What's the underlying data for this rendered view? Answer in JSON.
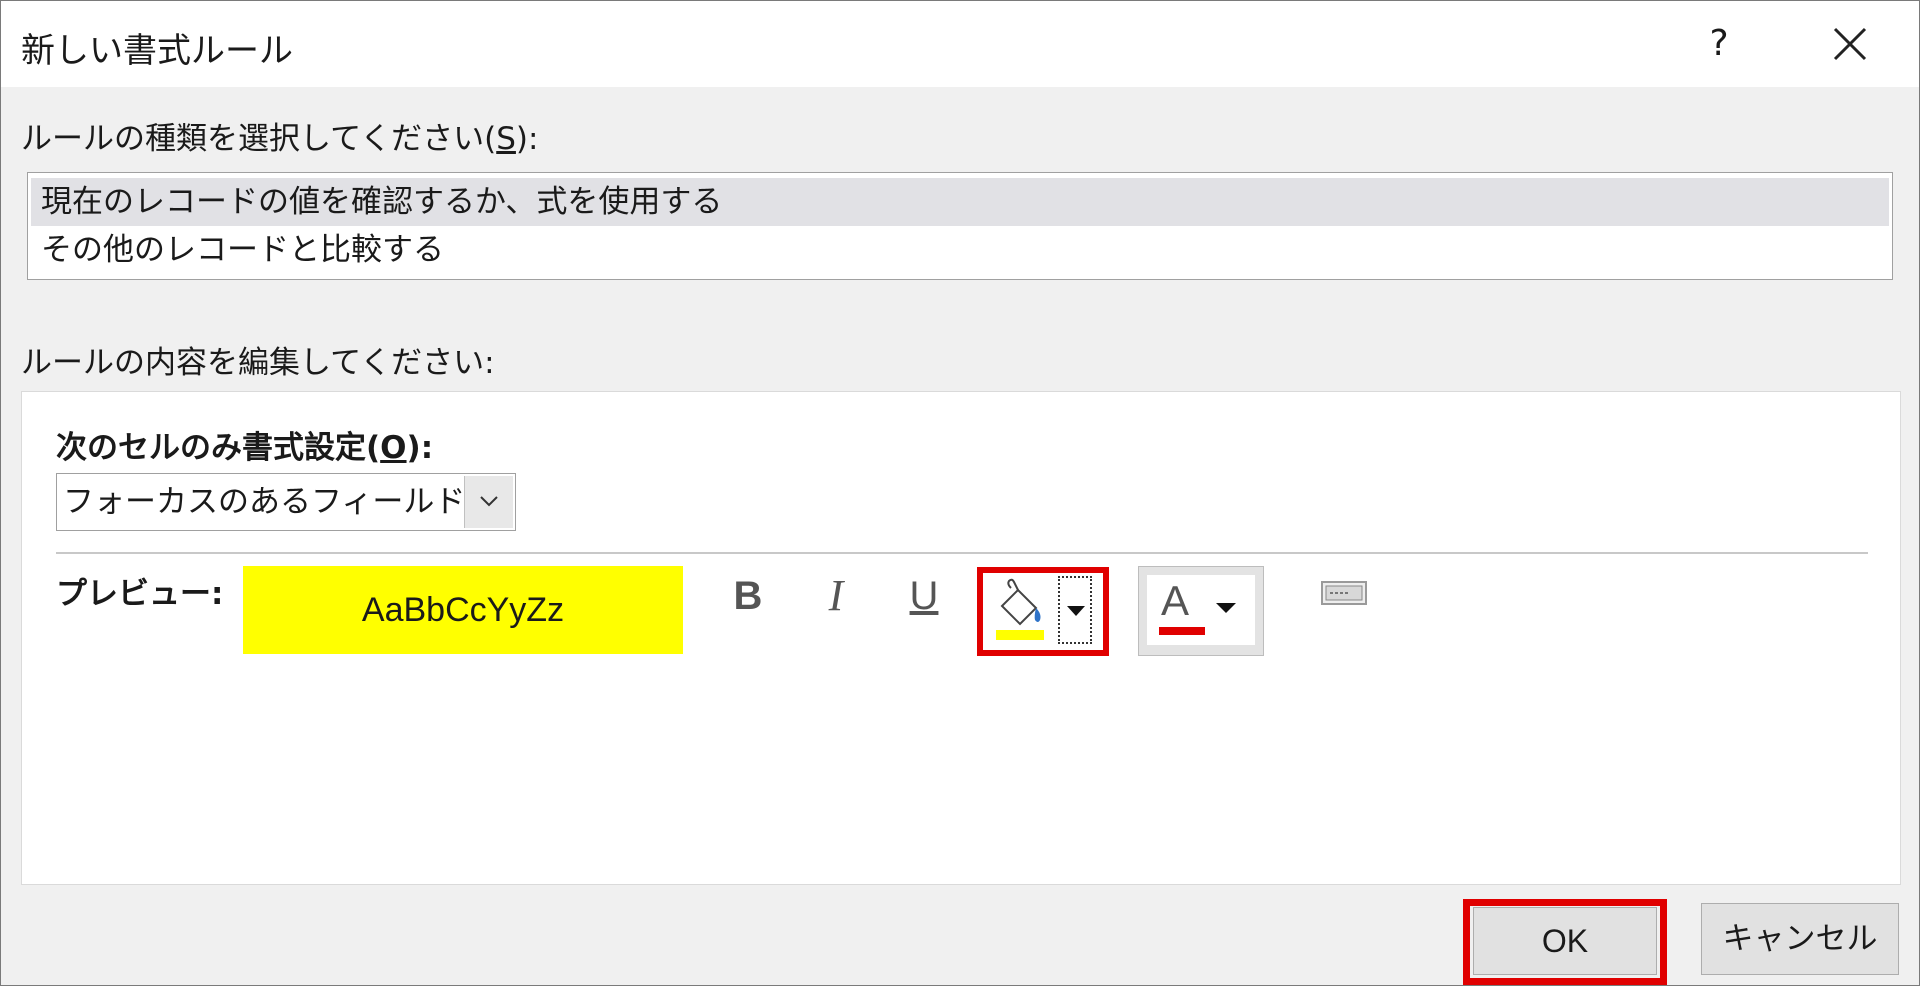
{
  "dialog": {
    "title": "新しい書式ルール",
    "help_label": "?"
  },
  "rule_type": {
    "label_prefix": "ルールの種類を選択してください(",
    "label_accel": "S",
    "label_suffix": "):",
    "items": [
      {
        "label": "現在のレコードの値を確認するか、式を使用する",
        "selected": true
      },
      {
        "label": "その他のレコードと比較する",
        "selected": false
      }
    ]
  },
  "rule_edit": {
    "label": "ルールの内容を編集してください:",
    "format_label_prefix": "次のセルのみ書式設定(",
    "format_label_accel": "O",
    "format_label_suffix": "):",
    "condition_value": "フォーカスのあるフィールド",
    "preview_label": "プレビュー:",
    "preview_text": "AaBbCcYyZz",
    "preview_bg_color": "#ffff00",
    "bold_label": "B",
    "italic_label": "I",
    "underline_label": "U",
    "font_color_glyph": "A",
    "fill_color": "#ffff00",
    "font_color": "#e00000"
  },
  "buttons": {
    "ok_label": "OK",
    "cancel_label": "キャンセル"
  },
  "colors": {
    "highlight_red": "#e00000"
  }
}
